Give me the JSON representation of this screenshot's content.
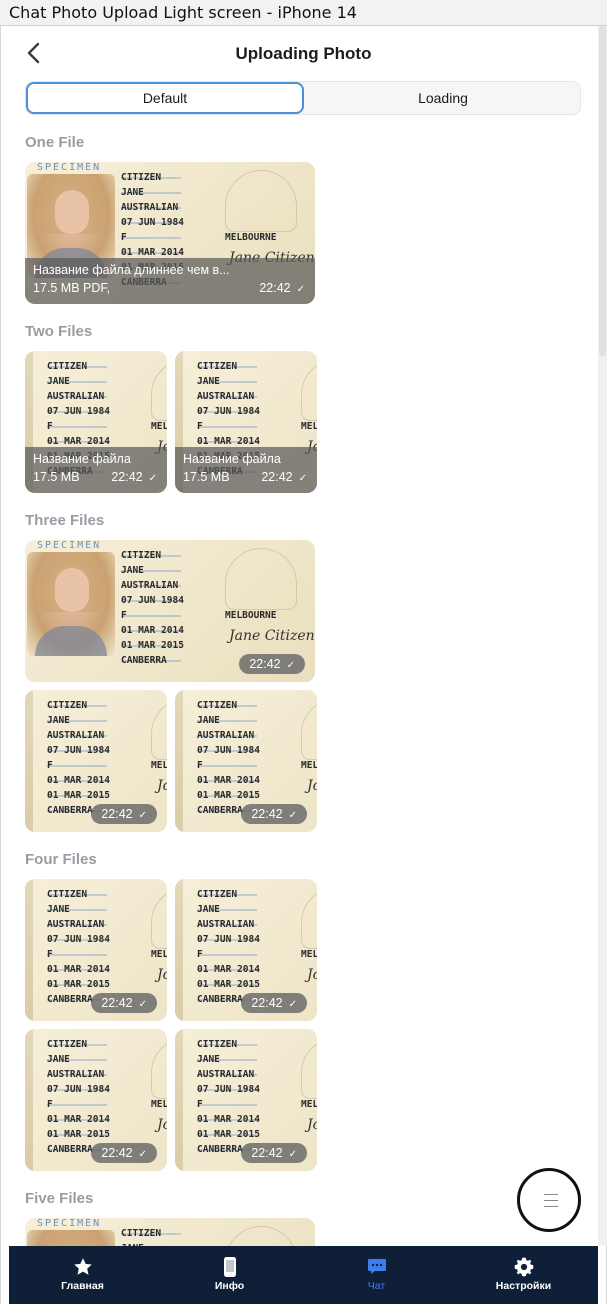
{
  "window_title": "Chat Photo Upload Light screen - iPhone 14",
  "nav": {
    "title": "Uploading Photo"
  },
  "segments": {
    "default_label": "Default",
    "loading_label": "Loading"
  },
  "sections": {
    "one": "One File",
    "two": "Two Files",
    "three": "Three Files",
    "four": "Four Files",
    "five": "Five Files"
  },
  "id_card": {
    "specimen": "SPECIMEN",
    "surname": "CITIZEN",
    "given": "JANE",
    "nationality": "AUSTRALIAN",
    "dob": "07 JUN 1984",
    "sex": "F",
    "issued": "01 MAR 2014",
    "expiry": "01 MAR 2015",
    "authority": "CANBERRA",
    "place": "MELBOURNE",
    "place_short": "MEL",
    "signature": "Jane Citizen",
    "signature_short": "Jo"
  },
  "one_file": {
    "name": "Название файла длиннее чем в...",
    "size": "17.5 MB PDF,",
    "time": "22:42"
  },
  "two_files": [
    {
      "name": "Название файла",
      "size": "17.5 MB",
      "time": "22:42"
    },
    {
      "name": "Название файла",
      "size": "17.5 MB",
      "time": "22:42"
    }
  ],
  "time_label": "22:42",
  "check_glyph": "✓",
  "tabs": [
    {
      "label": "Главная",
      "icon": "star-icon"
    },
    {
      "label": "Инфо",
      "icon": "phone-icon"
    },
    {
      "label": "Чат",
      "icon": "chat-icon"
    },
    {
      "label": "Настройки",
      "icon": "gear-icon"
    }
  ],
  "colors": {
    "accent": "#3f7cf0",
    "tabbar": "#0f1f38",
    "segment_border": "#4a90d9"
  }
}
